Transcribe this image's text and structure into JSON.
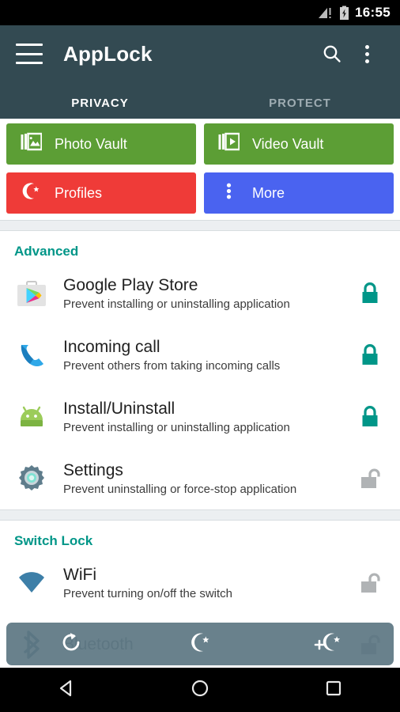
{
  "statusbar": {
    "time": "16:55",
    "signal_icon": "signal-no-service-icon",
    "battery_icon": "battery-charging-icon"
  },
  "appbar": {
    "menu_icon": "hamburger-menu-icon",
    "title": "AppLock",
    "search_icon": "search-icon",
    "overflow_icon": "overflow-menu-icon"
  },
  "tabs": [
    {
      "label": "PRIVACY",
      "active": true
    },
    {
      "label": "PROTECT",
      "active": false
    }
  ],
  "quick_actions": [
    {
      "label": "Photo Vault",
      "icon": "photo-vault-icon",
      "color": "#5c9e35"
    },
    {
      "label": "Video Vault",
      "icon": "video-vault-icon",
      "color": "#5c9e35"
    },
    {
      "label": "Profiles",
      "icon": "moon-star-icon",
      "color": "#ef3b38"
    },
    {
      "label": "More",
      "icon": "overflow-menu-icon",
      "color": "#4a63f0"
    }
  ],
  "sections": [
    {
      "title": "Advanced",
      "items": [
        {
          "title": "Google Play Store",
          "subtitle": "Prevent installing or uninstalling application",
          "icon": "google-play-store-icon",
          "lock": "locked"
        },
        {
          "title": "Incoming call",
          "subtitle": "Prevent others from taking incoming calls",
          "icon": "phone-icon",
          "lock": "locked"
        },
        {
          "title": "Install/Uninstall",
          "subtitle": "Prevent installing or uninstalling application",
          "icon": "android-robot-icon",
          "lock": "locked"
        },
        {
          "title": "Settings",
          "subtitle": "Prevent uninstalling or force-stop application",
          "icon": "gear-icon",
          "lock": "unlocked"
        }
      ]
    },
    {
      "title": "Switch Lock",
      "items": [
        {
          "title": "WiFi",
          "subtitle": "Prevent turning on/off the switch",
          "icon": "wifi-icon",
          "lock": "unlocked"
        },
        {
          "title": "Bluetooth",
          "subtitle": "",
          "icon": "bluetooth-icon",
          "lock": "unlocked"
        }
      ]
    }
  ],
  "floating_toolbar": [
    {
      "icon": "refresh-icon"
    },
    {
      "icon": "moon-star-icon"
    },
    {
      "icon": "add-profile-icon"
    }
  ],
  "navbar": [
    {
      "icon": "back-icon"
    },
    {
      "icon": "home-icon"
    },
    {
      "icon": "recents-icon"
    }
  ],
  "colors": {
    "accent_teal": "#009688",
    "appbar": "#334a52",
    "locked": "#009688",
    "unlocked": "#b0b3b5"
  }
}
